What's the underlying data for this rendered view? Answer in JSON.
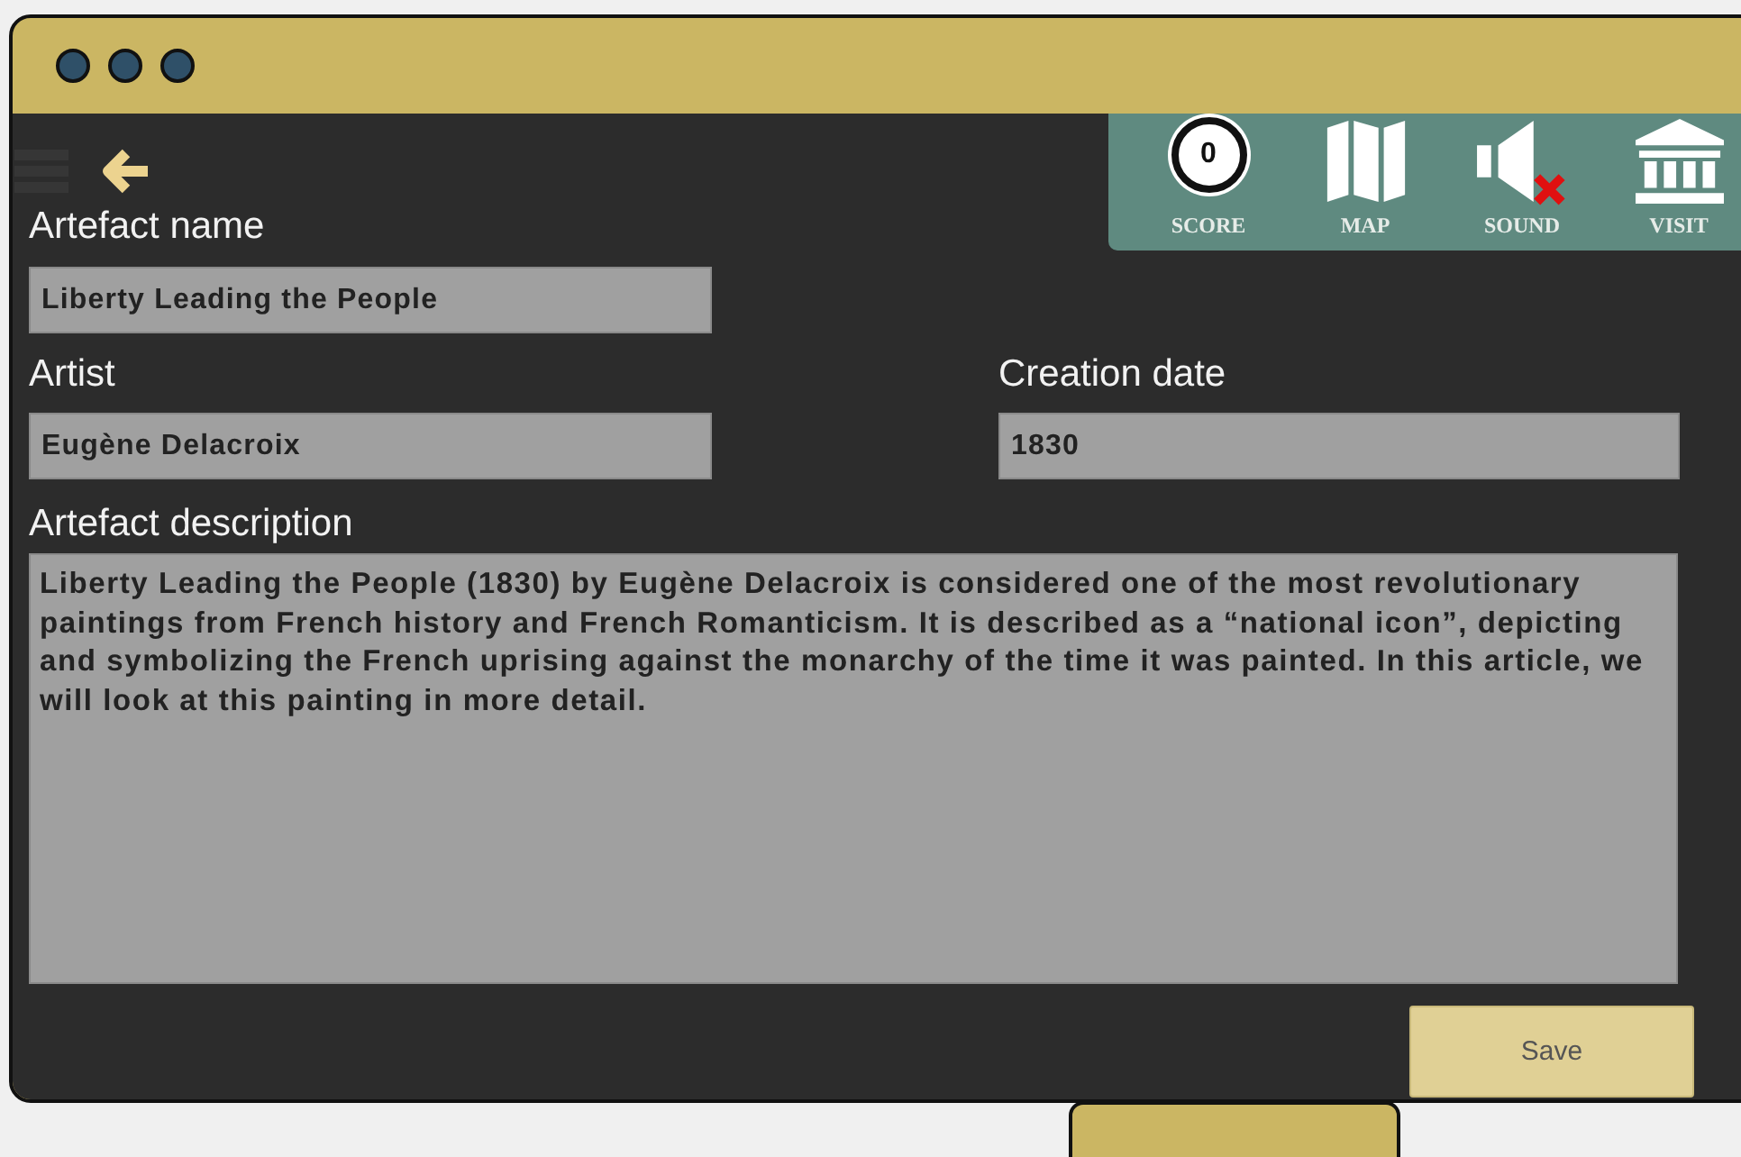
{
  "toolbar": {
    "items": [
      {
        "kind": "score",
        "label": "SCORE",
        "value": "0"
      },
      {
        "kind": "map",
        "label": "MAP"
      },
      {
        "kind": "sound",
        "label": "SOUND",
        "muted": true
      },
      {
        "kind": "visit",
        "label": "VISIT"
      }
    ]
  },
  "form": {
    "name": {
      "label": "Artefact name",
      "value": "Liberty Leading the People"
    },
    "artist": {
      "label": "Artist",
      "value": "Eugène Delacroix"
    },
    "date": {
      "label": "Creation date",
      "value": "1830"
    },
    "description": {
      "label": "Artefact description",
      "value": "Liberty Leading the People (1830) by Eugène Delacroix is considered one of the most revolutionary paintings from French history and French Romanticism. It is described as a “national icon”, depicting and symbolizing the French uprising against the monarchy of the time it was painted. In this article, we will look at this painting in more detail."
    }
  },
  "save_button": "Save"
}
